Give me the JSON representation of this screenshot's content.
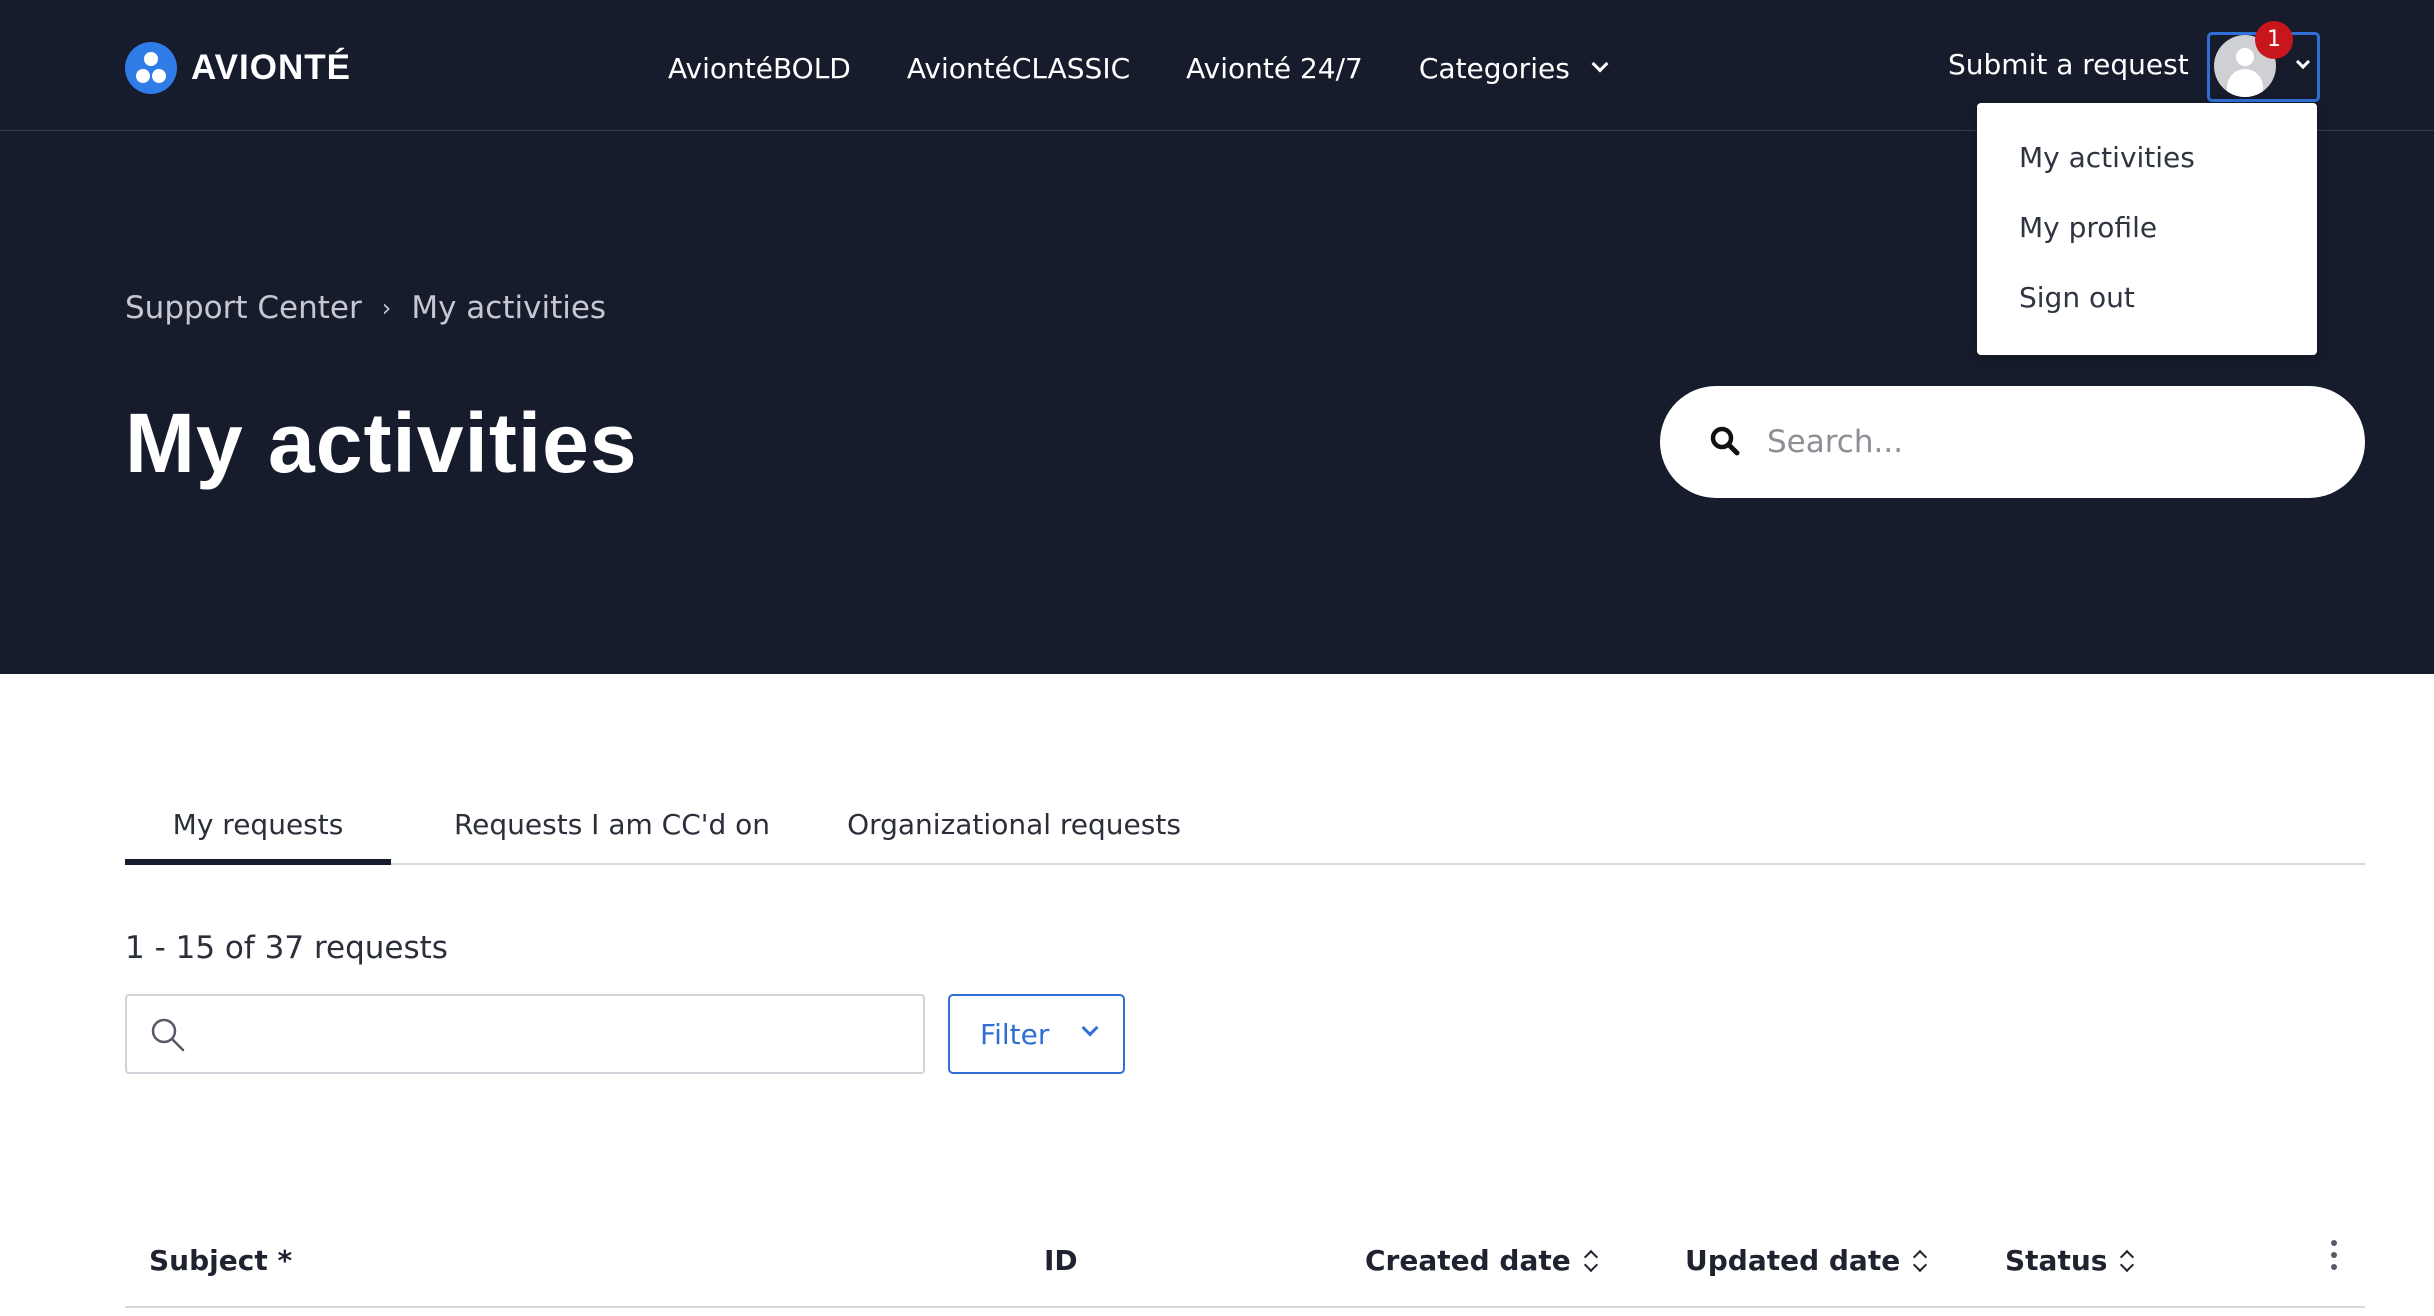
{
  "brand": {
    "name": "AVIONTÉ",
    "logo_color": "#2f7ce6"
  },
  "nav": {
    "items": [
      {
        "label": "AviontéBOLD"
      },
      {
        "label": "AviontéCLASSIC"
      },
      {
        "label": "Avionté 24/7"
      },
      {
        "label": "Categories"
      }
    ],
    "submit_request": "Submit a request"
  },
  "user_menu": {
    "notification_count": "1",
    "items": [
      {
        "label": "My activities"
      },
      {
        "label": "My profile"
      },
      {
        "label": "Sign out"
      }
    ]
  },
  "breadcrumb": {
    "items": [
      "Support Center",
      "My activities"
    ],
    "separator": "›"
  },
  "page_title": "My activities",
  "hero_search": {
    "placeholder": "Search..."
  },
  "tabs": [
    {
      "label": "My requests",
      "active": true
    },
    {
      "label": "Requests I am CC'd on",
      "active": false
    },
    {
      "label": "Organizational requests",
      "active": false
    }
  ],
  "results": {
    "count_text": "1 - 15 of 37 requests"
  },
  "filter": {
    "search_value": "",
    "button_label": "Filter"
  },
  "table": {
    "columns": [
      {
        "label": "Subject *",
        "sortable": false
      },
      {
        "label": "ID",
        "sortable": false
      },
      {
        "label": "Created date",
        "sortable": true
      },
      {
        "label": "Updated date",
        "sortable": true
      },
      {
        "label": "Status",
        "sortable": true
      }
    ]
  },
  "colors": {
    "hero_background": "#171c2c",
    "accent": "#2f6fd6",
    "badge": "#c9161d"
  }
}
